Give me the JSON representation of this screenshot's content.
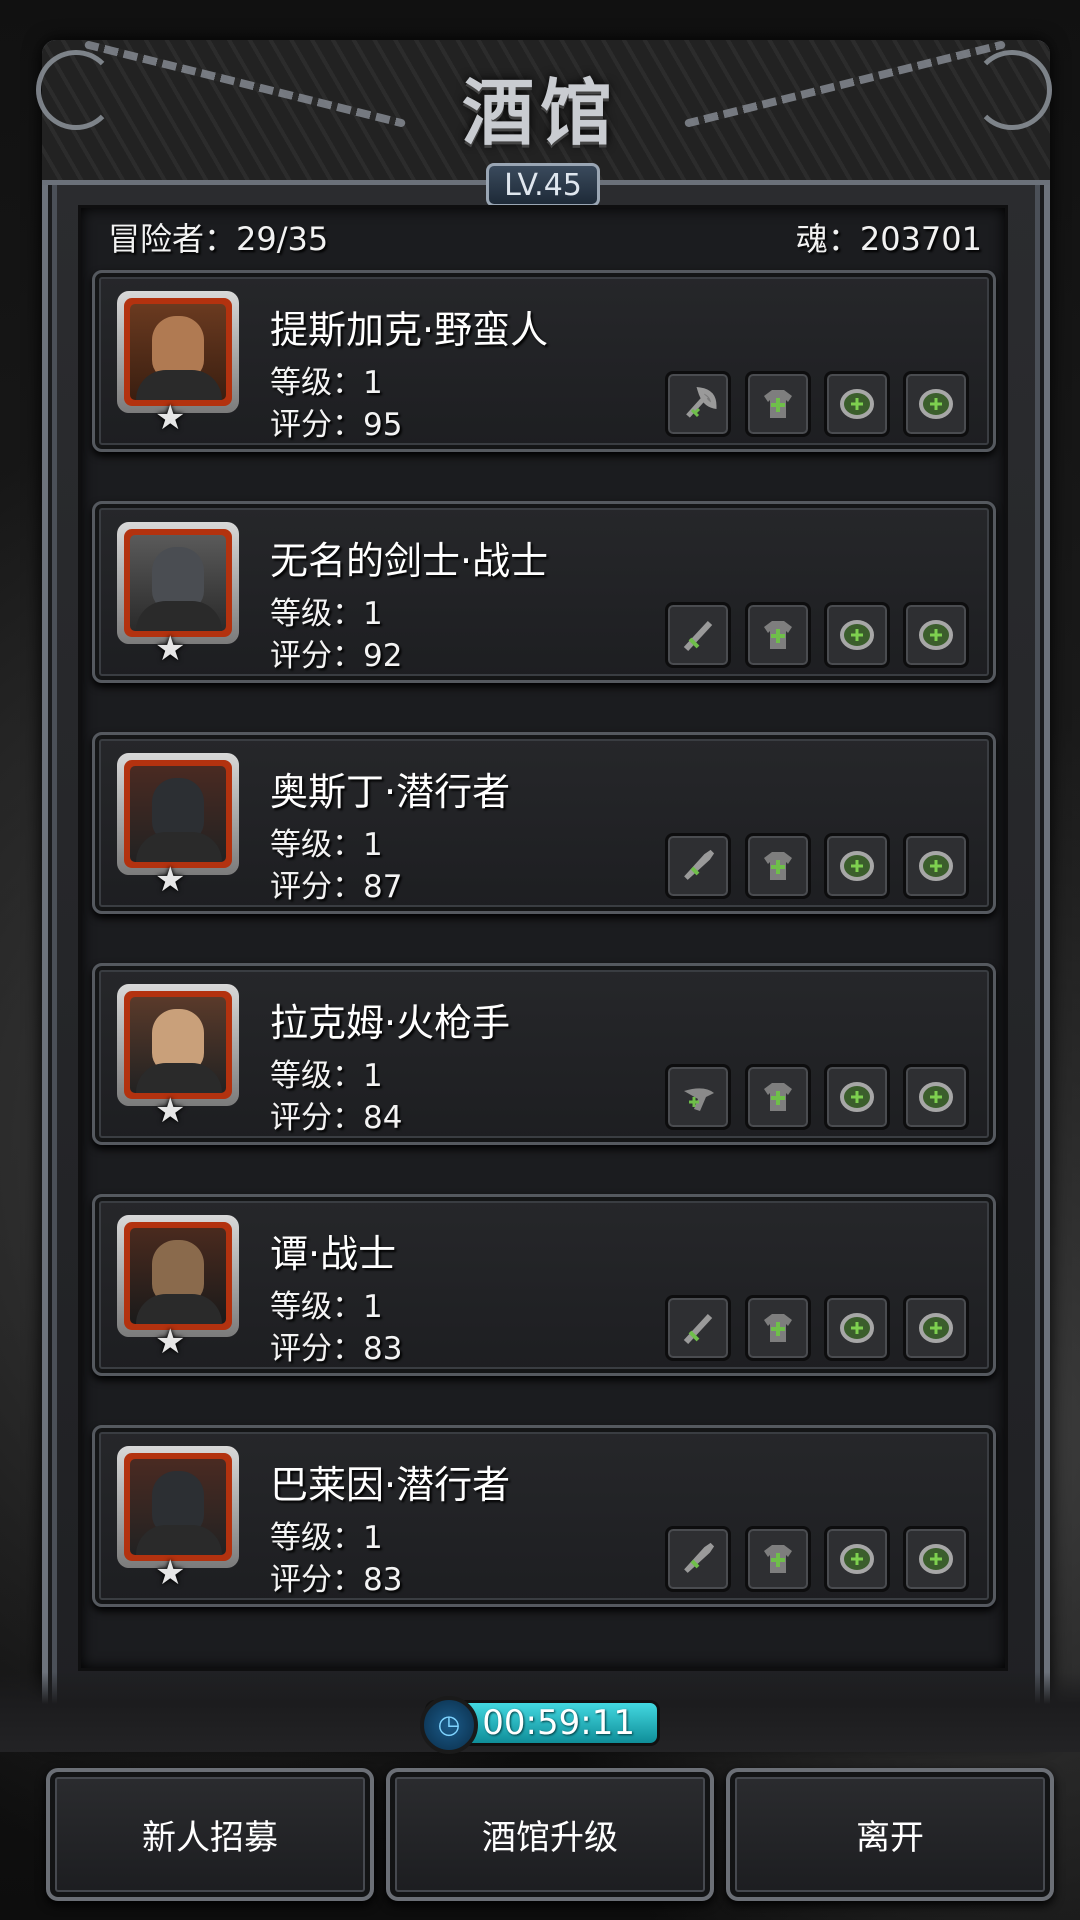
{
  "header": {
    "title": "酒馆",
    "level": "LV.45"
  },
  "stats": {
    "adventurers": "冒险者：29/35",
    "soul": "魂：203701"
  },
  "adventurers": [
    {
      "name": "提斯加克·野蛮人",
      "level": "等级：1",
      "score": "评分：95",
      "portrait": "barbarian-portrait",
      "weapon_icon": "axe-icon"
    },
    {
      "name": "无名的剑士·战士",
      "level": "等级：1",
      "score": "评分：92",
      "portrait": "knight-portrait",
      "weapon_icon": "sword-icon"
    },
    {
      "name": "奥斯丁·潜行者",
      "level": "等级：1",
      "score": "评分：87",
      "portrait": "ninja-portrait",
      "weapon_icon": "dagger-icon"
    },
    {
      "name": "拉克姆·火枪手",
      "level": "等级：1",
      "score": "评分：84",
      "portrait": "gunner-portrait",
      "weapon_icon": "gun-icon"
    },
    {
      "name": "谭·战士",
      "level": "等级：1",
      "score": "评分：83",
      "portrait": "hat-warrior-portrait",
      "weapon_icon": "sword-icon"
    },
    {
      "name": "巴莱因·潜行者",
      "level": "等级：1",
      "score": "评分：83",
      "portrait": "ninja-portrait",
      "weapon_icon": "dagger-icon"
    }
  ],
  "timer": {
    "value": "00:59:11"
  },
  "buttons": {
    "recruit": "新人招募",
    "upgrade": "酒馆升级",
    "leave": "离开"
  },
  "colors": {
    "accent": "#3fd3dc",
    "portrait_border": "#b3320f",
    "slot_plus": "#6fbf4a"
  }
}
